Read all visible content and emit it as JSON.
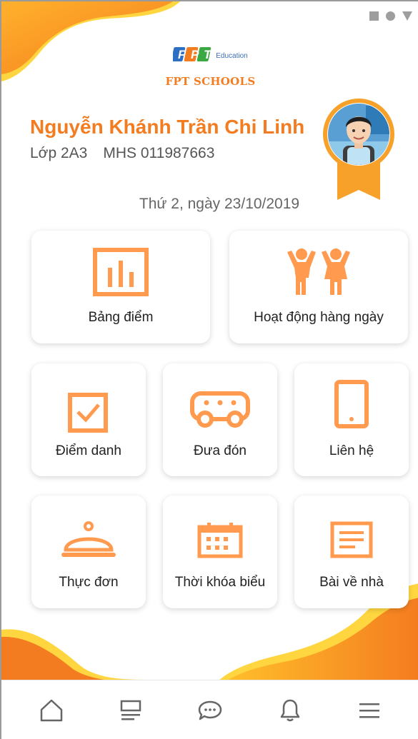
{
  "brand": {
    "logo_letters": [
      "F",
      "P",
      "T"
    ],
    "logo_suffix": "Education",
    "school_name": "FPT SCHOOLS"
  },
  "student": {
    "name": "Nguyễn Khánh Trần Chi Linh",
    "class_label": "Lớp 2A3",
    "student_id_label": "MHS 011987663"
  },
  "date_text": "Thứ 2, ngày 23/10/2019",
  "menu": {
    "grades": {
      "label": "Bảng điểm",
      "icon": "bar-chart-icon"
    },
    "activities": {
      "label": "Hoạt động hàng ngày",
      "icon": "kids-activity-icon"
    },
    "attendance": {
      "label": "Điểm danh",
      "icon": "checkbox-icon"
    },
    "pickup": {
      "label": "Đưa đón",
      "icon": "bus-icon"
    },
    "contact": {
      "label": "Liên hệ",
      "icon": "phone-icon"
    },
    "menu_food": {
      "label": "Thực đơn",
      "icon": "food-cloche-icon"
    },
    "timetable": {
      "label": "Thời khóa biểu",
      "icon": "calendar-icon"
    },
    "homework": {
      "label": "Bài về nhà",
      "icon": "document-icon"
    }
  },
  "bottom_nav": [
    "home-icon",
    "news-icon",
    "chat-icon",
    "bell-icon",
    "menu-icon"
  ],
  "colors": {
    "accent": "#f47c20",
    "accent_light": "#ffa24a",
    "yellow": "#ffcf3a",
    "icon_orange": "#ff9a4e",
    "text_dark": "#222222",
    "text_gray": "#555555"
  }
}
